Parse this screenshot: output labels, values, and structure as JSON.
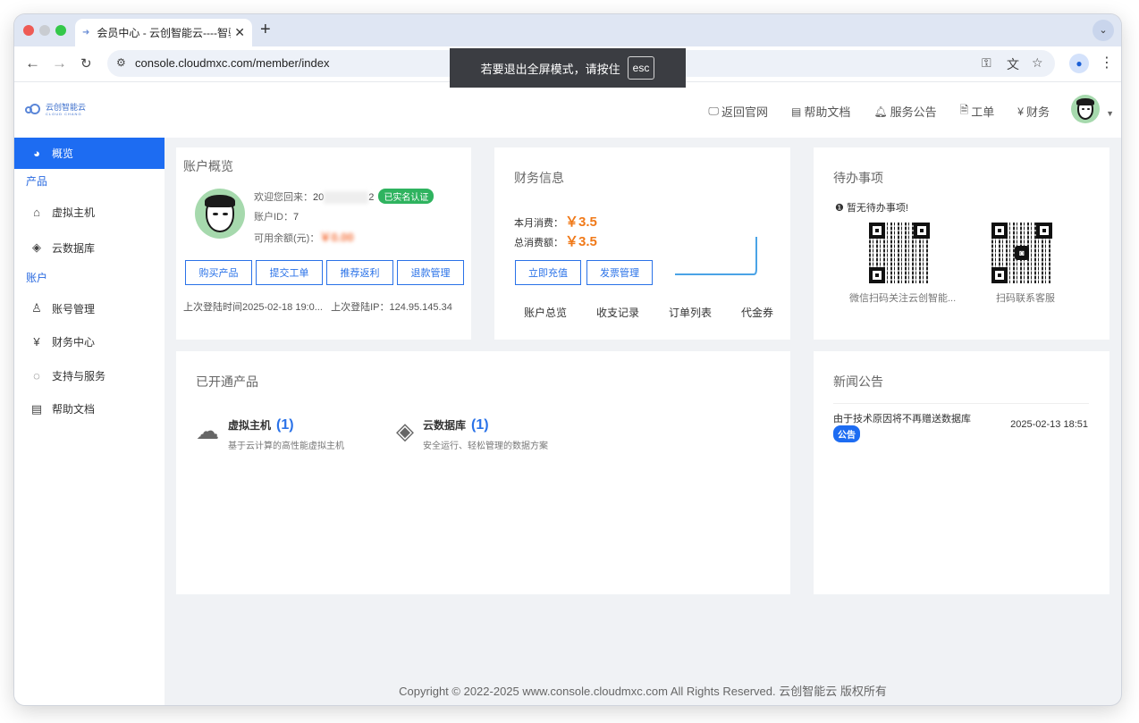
{
  "browser": {
    "tab_title": "会员中心 - 云创智能云----智驭",
    "tab_close": "✕",
    "new_tab": "+",
    "tab_menu": "⌄",
    "url": "console.cloudmxc.com/member/index",
    "fullscreen_notice": "若要退出全屏模式，请按住",
    "fullscreen_key": "esc"
  },
  "header": {
    "logo_text": "云创智能云",
    "logo_subtext": "CLOUD CHANG",
    "nav": [
      {
        "label": "返回官网",
        "icon": "monitor-icon"
      },
      {
        "label": "帮助文档",
        "icon": "doc-icon"
      },
      {
        "label": "服务公告",
        "icon": "bell-icon"
      },
      {
        "label": "工单",
        "icon": "ticket-icon"
      },
      {
        "label": "财务",
        "icon": "yen-icon"
      }
    ]
  },
  "sidebar": {
    "active": {
      "label": "概览"
    },
    "group_products": "产品",
    "products": [
      {
        "label": "虚拟主机"
      },
      {
        "label": "云数据库"
      }
    ],
    "group_account": "账户",
    "account": [
      {
        "label": "账号管理"
      },
      {
        "label": "财务中心"
      },
      {
        "label": "支持与服务"
      },
      {
        "label": "帮助文档"
      }
    ]
  },
  "account": {
    "title": "账户概览",
    "welcome_label": "欢迎您回来：",
    "username_visible_start": "20",
    "username_visible_end": "2",
    "verified_badge": "已实名认证",
    "id_label": "账户ID：",
    "id_value": "7",
    "balance_label": "可用余额(元)：",
    "balance_value": "￥0.00",
    "buttons": [
      "购买产品",
      "提交工单",
      "推荐返利",
      "退款管理"
    ],
    "last_login_time_label": "上次登陆时间",
    "last_login_time": "2025-02-18 19:0...",
    "last_login_ip_label": "上次登陆IP：",
    "last_login_ip": "124.95.145.34"
  },
  "finance": {
    "title": "财务信息",
    "month_label": "本月消费：",
    "month_value": "￥3.5",
    "total_label": "总消费额：",
    "total_value": "￥3.5",
    "buttons": [
      "立即充值",
      "发票管理"
    ],
    "links": [
      "账户总览",
      "收支记录",
      "订单列表",
      "代金券"
    ]
  },
  "todo": {
    "title": "待办事项",
    "empty_note": "暂无待办事项!",
    "qr_left_caption": "微信扫码关注云创智能...",
    "qr_right_caption": "扫码联系客服"
  },
  "products": {
    "title": "已开通产品",
    "items": [
      {
        "name": "虚拟主机",
        "count": "(1)",
        "desc": "基于云计算的高性能虚拟主机"
      },
      {
        "name": "云数据库",
        "count": "(1)",
        "desc": "安全运行、轻松管理的数据方案"
      }
    ]
  },
  "news": {
    "title": "新闻公告",
    "items": [
      {
        "title": "由于技术原因将不再赠送数据库",
        "tag": "公告",
        "date": "2025-02-13 18:51"
      }
    ]
  },
  "footer": "Copyright © 2022-2025 www.console.cloudmxc.com All Rights Reserved. 云创智能云 版权所有"
}
